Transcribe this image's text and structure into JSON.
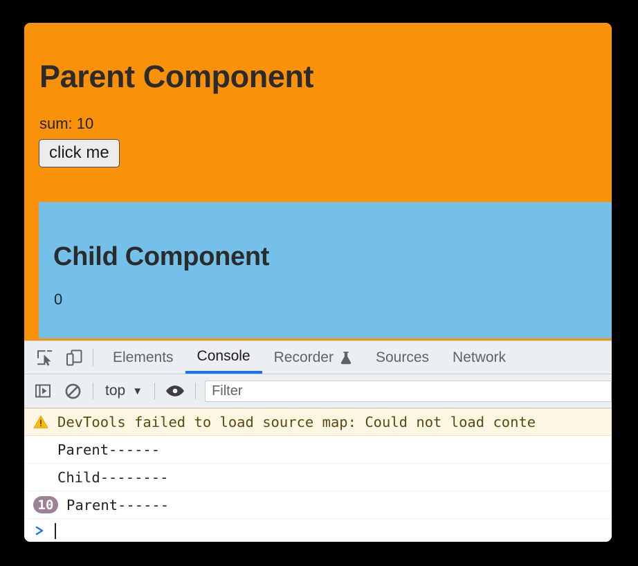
{
  "page": {
    "parent": {
      "title": "Parent Component",
      "sum_label": "sum: 10",
      "button_label": "click me",
      "bg_color": "#f99208"
    },
    "child": {
      "title": "Child Component",
      "count": "0",
      "bg_color": "#74c0e9"
    }
  },
  "devtools": {
    "toolbar_icons": [
      {
        "name": "inspect-element-icon",
        "label": "Inspect element"
      },
      {
        "name": "device-toolbar-icon",
        "label": "Toggle device toolbar"
      }
    ],
    "tabs": [
      {
        "label": "Elements",
        "active": false,
        "icon": ""
      },
      {
        "label": "Console",
        "active": true,
        "icon": ""
      },
      {
        "label": "Recorder",
        "active": false,
        "icon": "flask-icon"
      },
      {
        "label": "Sources",
        "active": false,
        "icon": ""
      },
      {
        "label": "Network",
        "active": false,
        "icon": ""
      }
    ],
    "console_bar": {
      "sidebar_toggle": "console-sidebar-icon",
      "clear_console": "clear-console-icon",
      "context_label": "top",
      "context_caret": "▼",
      "live_expression": "eye-icon",
      "filter_placeholder": "Filter",
      "filter_value": ""
    },
    "messages": [
      {
        "type": "warning",
        "icon": "warning-triangle-icon",
        "text": "DevTools failed to load source map: Could not load conte",
        "count": null
      },
      {
        "type": "log",
        "text": "Parent------",
        "count": null
      },
      {
        "type": "log",
        "text": "Child--------",
        "count": null
      },
      {
        "type": "log",
        "text": "Parent------",
        "count": "10"
      }
    ],
    "prompt": {
      "arrow": ">",
      "value": ""
    },
    "accent_color": "#1a73e8",
    "badge_color": "#9b8296",
    "warning_bg": "#fdf6e3"
  }
}
